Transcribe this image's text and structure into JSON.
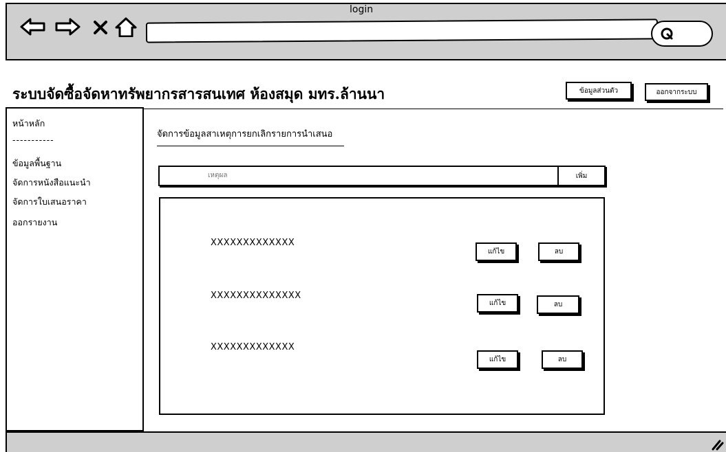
{
  "browser": {
    "title": "login",
    "address": ""
  },
  "header": {
    "app_title": "ระบบจัดซื้อจัดหาทรัพยากรสารสนเทศ ห้องสมุด มทร.ล้านนา",
    "profile_button": "ข้อมูลส่วนตัว",
    "logout_button": "ออกจากระบบ"
  },
  "sidebar": {
    "items": [
      {
        "label": "หน้าหลัก"
      },
      {
        "label": "-----------"
      },
      {
        "label": "ข้อมูลพื้นฐาน"
      },
      {
        "label": "จัดการหนังสือแนะนำ"
      },
      {
        "label": "จัดการใบเสนอราคา"
      },
      {
        "label": "ออกรายงาน"
      }
    ]
  },
  "main": {
    "heading": "จัดการข้อมูลสาเหตุการยกเลิกรายการนำเสนอ",
    "reason_placeholder": "เหตุผล",
    "add_button": "เพิ่ม",
    "rows": [
      {
        "text": "XXXXXXXXXXXXX",
        "edit": "แก้ไข",
        "delete": "ลบ"
      },
      {
        "text": "XXXXXXXXXXXXXX",
        "edit": "แก้ไข",
        "delete": "ลบ"
      },
      {
        "text": "XXXXXXXXXXXXX",
        "edit": "แก้ไข",
        "delete": "ลบ"
      }
    ]
  },
  "icons": [
    "back-arrow-icon",
    "forward-arrow-icon",
    "close-icon",
    "home-icon",
    "search-icon",
    "resize-grip-icon"
  ]
}
